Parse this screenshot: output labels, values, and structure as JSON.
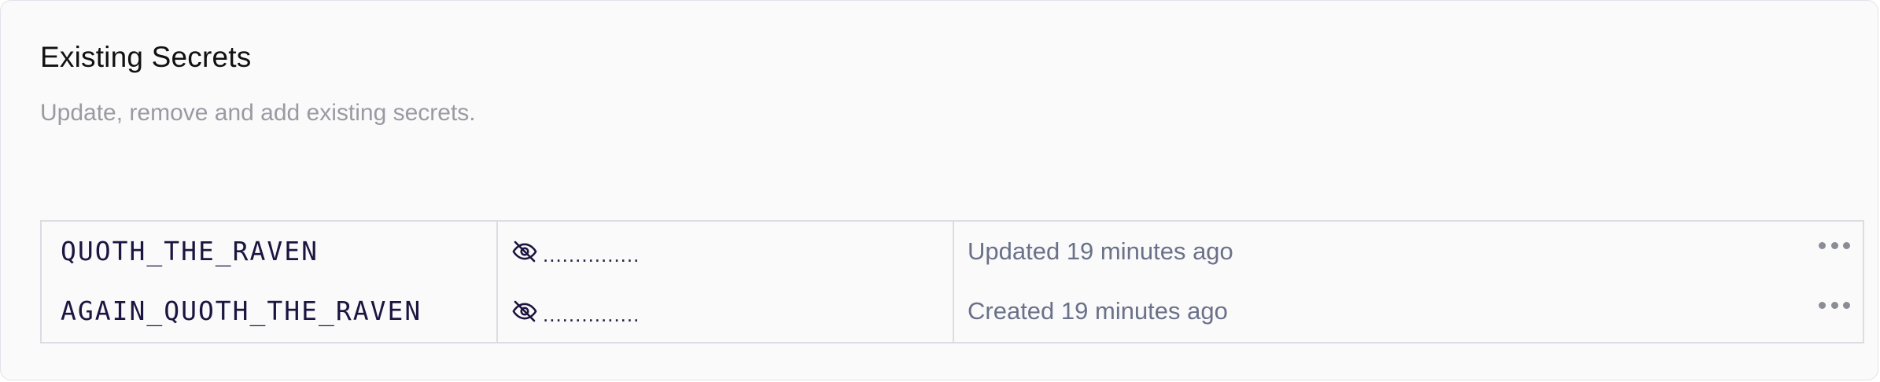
{
  "section": {
    "title": "Existing Secrets",
    "subtitle": "Update, remove and add existing secrets."
  },
  "secrets": [
    {
      "key": "QUOTH_THE_RAVEN",
      "masked_value": "...............",
      "status": "Updated 19 minutes ago",
      "visibility_icon": "eye-off-icon",
      "actions_icon": "more-horizontal-icon"
    },
    {
      "key": "AGAIN_QUOTH_THE_RAVEN",
      "masked_value": "...............",
      "status": "Created 19 minutes ago",
      "visibility_icon": "eye-off-icon",
      "actions_icon": "more-horizontal-icon"
    }
  ],
  "colors": {
    "key_text": "#1d1540",
    "status_text": "#6a7188",
    "subtitle_text": "#9a9aa3",
    "border": "#dcdde2"
  }
}
